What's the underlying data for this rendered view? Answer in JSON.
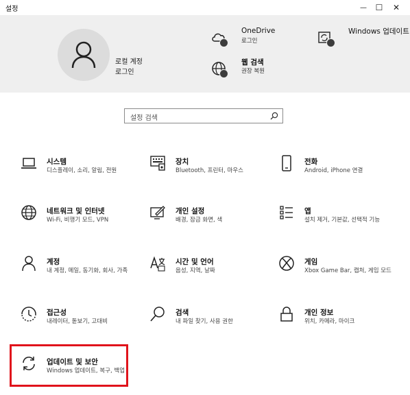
{
  "window": {
    "title": "설정",
    "minimize": "—",
    "maximize": "☐",
    "close": "✕"
  },
  "account": {
    "name": "로컬 계정",
    "type": "로그인"
  },
  "header_items": [
    {
      "title": "OneDrive",
      "sub": "로그인",
      "icon": "cloud-icon"
    },
    {
      "title": "웹 검색",
      "sub": "권장 복원",
      "icon": "globe-icon"
    },
    {
      "title": "Windows 업데이트",
      "sub": "",
      "icon": "windows-update-icon"
    }
  ],
  "search": {
    "placeholder": "설정 검색"
  },
  "tiles": [
    {
      "title": "시스템",
      "sub": "디스플레이, 소리, 알림, 전원",
      "icon": "laptop-icon"
    },
    {
      "title": "장치",
      "sub": "Bluetooth, 프린터, 마우스",
      "icon": "keyboard-icon"
    },
    {
      "title": "전화",
      "sub": "Android, iPhone 연결",
      "icon": "phone-icon"
    },
    {
      "title": "네트워크 및 인터넷",
      "sub": "Wi-Fi, 비행기 모드, VPN",
      "icon": "globe-icon"
    },
    {
      "title": "개인 설정",
      "sub": "배경, 잠금 화면, 색",
      "icon": "personalization-icon"
    },
    {
      "title": "앱",
      "sub": "설치 제거, 기본값, 선택적 기능",
      "icon": "apps-list-icon"
    },
    {
      "title": "계정",
      "sub": "내 계정, 메일, 동기화, 회사, 가족",
      "icon": "person-icon"
    },
    {
      "title": "시간 및 언어",
      "sub": "음성, 지역, 날짜",
      "icon": "time-language-icon"
    },
    {
      "title": "게임",
      "sub": "Xbox Game Bar, 캡처, 게임 모드",
      "icon": "xbox-icon"
    },
    {
      "title": "접근성",
      "sub": "내레이터, 돋보기, 고대비",
      "icon": "accessibility-icon"
    },
    {
      "title": "검색",
      "sub": "내 파일 찾기, 사용 권한",
      "icon": "search-icon"
    },
    {
      "title": "개인 정보",
      "sub": "위치, 카메라, 마이크",
      "icon": "lock-icon"
    },
    {
      "title": "업데이트 및 보안",
      "sub": "Windows 업데이트, 복구, 백업",
      "icon": "sync-icon"
    }
  ],
  "highlight_color": "#e0131b"
}
